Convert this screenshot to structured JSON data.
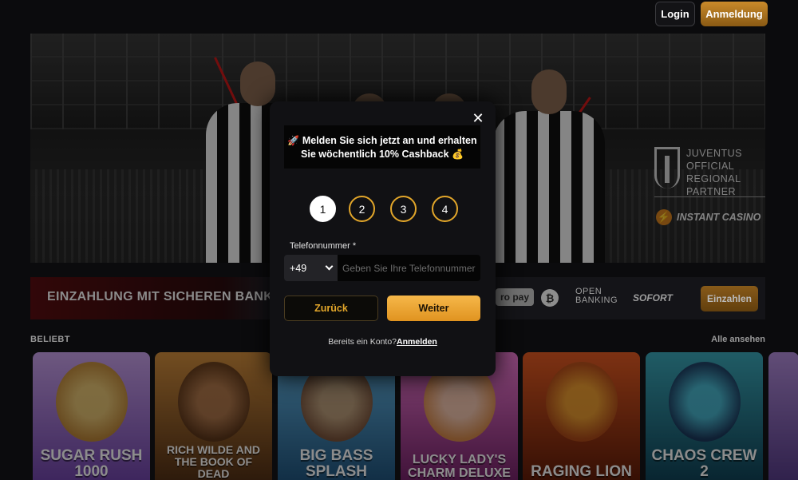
{
  "header": {
    "login_label": "Login",
    "register_label": "Anmeldung"
  },
  "hero": {
    "partner_line1": "Juventus",
    "partner_line2": "Official",
    "partner_line3": "Regional Partner",
    "brand": "Instant Casino"
  },
  "deposit_banner": {
    "title": "EINZAHLUNG MIT SICHEREN BANK",
    "methods": [
      "ro pay",
      "₿",
      "OPEN",
      "BANKING",
      "SOFORT"
    ],
    "deposit_label": "Einzahlen"
  },
  "popular": {
    "title": "BELIEBT",
    "see_all": "Alle ansehen",
    "games": [
      {
        "title": "Sugar Rush 1000"
      },
      {
        "title": "Rich Wilde and the Book of Dead"
      },
      {
        "title": "Big Bass Splash"
      },
      {
        "title": "Lucky Lady's Charm Deluxe"
      },
      {
        "title": "Raging Lion"
      },
      {
        "title": "Chaos Crew 2"
      }
    ]
  },
  "modal": {
    "promo_line1": "Melden Sie sich jetzt an und erhalten",
    "promo_line2": "Sie wöchentlich 10% Cashback",
    "promo_icon1": "🚀",
    "promo_icon2": "💰",
    "steps": [
      "1",
      "2",
      "3",
      "4"
    ],
    "active_step": 1,
    "phone_label": "Telefonnummer *",
    "country_code": "+49",
    "phone_placeholder": "Geben Sie Ihre Telefonnummer ein",
    "back_label": "Zurück",
    "next_label": "Weiter",
    "already_text": "Bereits ein Konto?",
    "login_link": "Anmelden"
  },
  "colors": {
    "accent": "#e2a62a",
    "background": "#0b0b0d",
    "modal_bg": "#111114"
  }
}
